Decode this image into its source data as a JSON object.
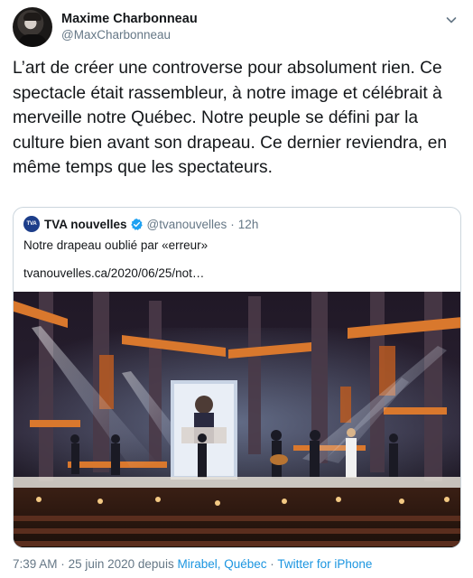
{
  "author": {
    "display_name": "Maxime Charbonneau",
    "handle": "@MaxCharbonneau"
  },
  "tweet_text": "L’art de créer une controverse pour absolument rien. Ce spectacle était rassembleur, à notre image et célébrait à merveille notre Québec. Notre peuple se défini par la culture bien avant son drapeau. Ce dernier reviendra, en même temps que les spectateurs.",
  "quoted": {
    "logo_text": "TVA",
    "name": "TVA nouvelles",
    "handle": "@tvanouvelles",
    "separator": "·",
    "time": "12h",
    "text": "Notre drapeau oublié par «erreur»",
    "link": "tvanouvelles.ca/2020/06/25/not…"
  },
  "footer": {
    "time": "7:39 AM",
    "sep1": "·",
    "date": "25 juin 2020",
    "depuis": "depuis",
    "location": "Mirabel, Québec",
    "sep2": "·",
    "client": "Twitter for iPhone"
  },
  "colors": {
    "text": "#14171a",
    "muted": "#657786",
    "link": "#1b95e0",
    "verified": "#1da1f2",
    "stage_orange": "#d9782d"
  },
  "icons": [
    "avatar",
    "chevron-down-icon",
    "tva-logo-icon",
    "verified-badge-icon"
  ]
}
